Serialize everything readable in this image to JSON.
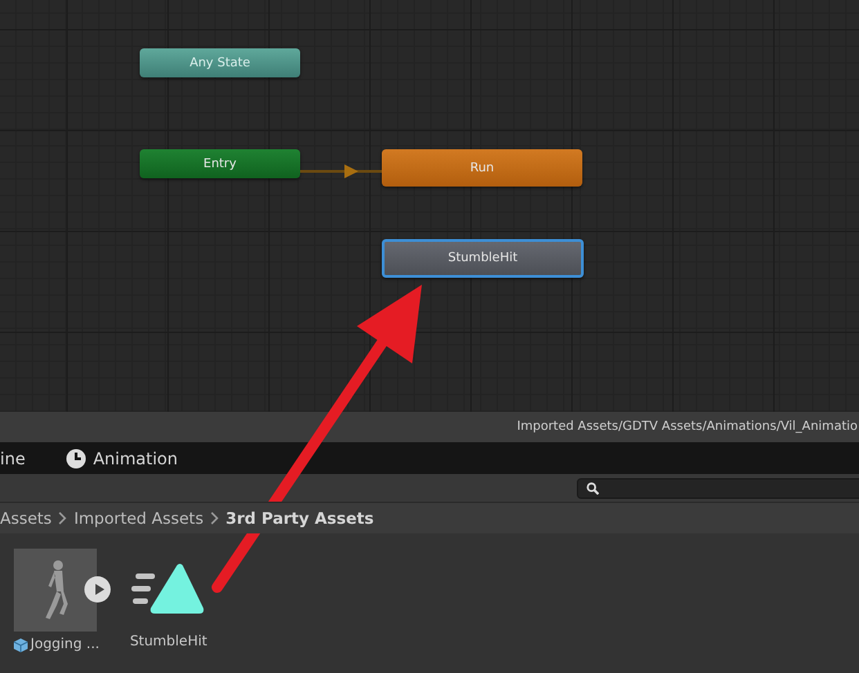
{
  "graph": {
    "nodes": [
      {
        "label": "Any State",
        "kind": "any_state",
        "selected": false
      },
      {
        "label": "Entry",
        "kind": "entry",
        "selected": false
      },
      {
        "label": "Run",
        "kind": "state",
        "selected": false
      },
      {
        "label": "StumbleHit",
        "kind": "state",
        "selected": true
      }
    ]
  },
  "path_bar": {
    "path": "Imported Assets/GDTV Assets/Animations/Vil_Animatio"
  },
  "tabs": [
    {
      "label": "ine",
      "icon": false,
      "selected": false
    },
    {
      "label": "Animation",
      "icon": true,
      "selected": false
    }
  ],
  "breadcrumb": [
    "Assets",
    "Imported Assets",
    "3rd Party Assets"
  ],
  "assets": [
    {
      "label": "Jogging ...",
      "kind": "model"
    },
    {
      "label": "StumbleHit",
      "kind": "clip"
    }
  ]
}
